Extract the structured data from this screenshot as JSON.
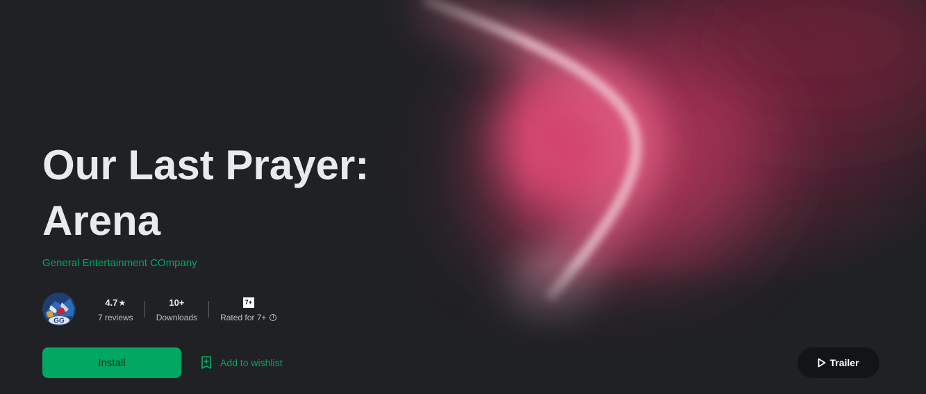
{
  "app": {
    "title_line1": "Our Last Prayer:",
    "title_line2": "Arena",
    "developer": "General Entertainment COmpany",
    "icon": "app-game-icon",
    "icon_badge": "GG"
  },
  "stats": {
    "rating": {
      "value": "4.7",
      "star": "★",
      "label": "7 reviews"
    },
    "downloads": {
      "value": "10+",
      "label": "Downloads"
    },
    "content_rating": {
      "badge": "7+",
      "label": "Rated for 7+",
      "info_icon": "info-icon"
    }
  },
  "actions": {
    "install_label": "Install",
    "wishlist_label": "Add to wishlist",
    "wishlist_icon": "bookmark-add-icon",
    "trailer_label": "Trailer",
    "trailer_icon": "play-icon"
  },
  "colors": {
    "background": "#202124",
    "accent_green": "#01a862",
    "title_text": "#e8eaed",
    "hero_pink": "#d94a72",
    "trailer_button_bg": "#131416"
  }
}
